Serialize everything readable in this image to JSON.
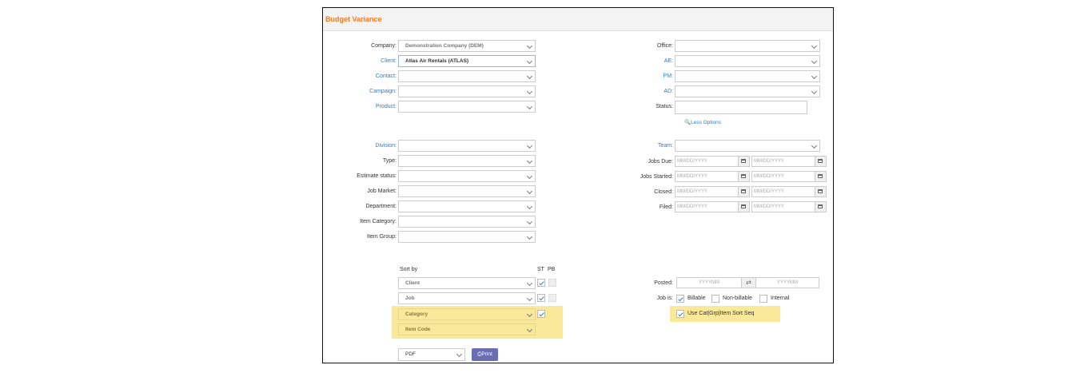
{
  "header": {
    "title": "Budget Variance"
  },
  "left_fields": [
    {
      "label": "Company:",
      "value": "Demonstration Company (DEM)",
      "blue": false
    },
    {
      "label": "Client:",
      "value": "Atlas Air Rentals (ATLAS)",
      "blue": true
    },
    {
      "label": "Contact:",
      "value": "",
      "blue": true
    },
    {
      "label": "Campaign:",
      "value": "",
      "blue": true
    },
    {
      "label": "Product:",
      "value": "",
      "blue": true
    }
  ],
  "right_fields": [
    {
      "label": "Office:",
      "value": ""
    },
    {
      "label": "AE:",
      "value": ""
    },
    {
      "label": "PM:",
      "value": ""
    },
    {
      "label": "AD:",
      "value": ""
    },
    {
      "label": "Status:",
      "value": ""
    }
  ],
  "less_options": "Less Options",
  "left_fields2": [
    {
      "label": "Division:",
      "value": ""
    },
    {
      "label": "Type:",
      "value": ""
    },
    {
      "label": "Estimate status:",
      "value": ""
    },
    {
      "label": "Job Market:",
      "value": ""
    },
    {
      "label": "Department:",
      "value": ""
    },
    {
      "label": "Item Category:",
      "value": ""
    },
    {
      "label": "Item Group:",
      "value": ""
    }
  ],
  "team": {
    "label": "Team:",
    "value": ""
  },
  "date_fields": [
    {
      "label": "Jobs Due:",
      "from": "MM/DD/YYYY",
      "to": "MM/DD/YYYY"
    },
    {
      "label": "Jobs Started:",
      "from": "MM/DD/YYYY",
      "to": "MM/DD/YYYY"
    },
    {
      "label": "Closed:",
      "from": "MM/DD/YYYY",
      "to": "MM/DD/YYYY"
    },
    {
      "label": "Filed:",
      "from": "MM/DD/YYYY",
      "to": "MM/DD/YYYY"
    }
  ],
  "sort": {
    "label": "Sort by",
    "st_label": "ST",
    "pb_label": "PB",
    "rows": [
      {
        "value": "Client",
        "st": true,
        "pb": false
      },
      {
        "value": "Job",
        "st": true,
        "pb": false
      },
      {
        "value": "Category",
        "st": true,
        "pb": null
      },
      {
        "value": "Item Code",
        "st": null,
        "pb": null
      }
    ]
  },
  "posted": {
    "label": "Posted:",
    "from": "YYYYMM",
    "to": "YYYYMM",
    "swap": "⇄"
  },
  "job_is": {
    "label": "Job is:",
    "options": [
      {
        "label": "Billable",
        "checked": true
      },
      {
        "label": "Non-billable",
        "checked": false
      },
      {
        "label": "Internal",
        "checked": false
      }
    ]
  },
  "use_cat": {
    "label": "Use Cat|Grp|Item Sort Seq",
    "checked": true
  },
  "output": {
    "format": "PDF",
    "print_label": "Print"
  },
  "colors": {
    "accent_orange": "#f47b20",
    "link_blue": "#2e7cc4",
    "highlight": "#fae99a",
    "print_button": "#6a6eb0"
  }
}
